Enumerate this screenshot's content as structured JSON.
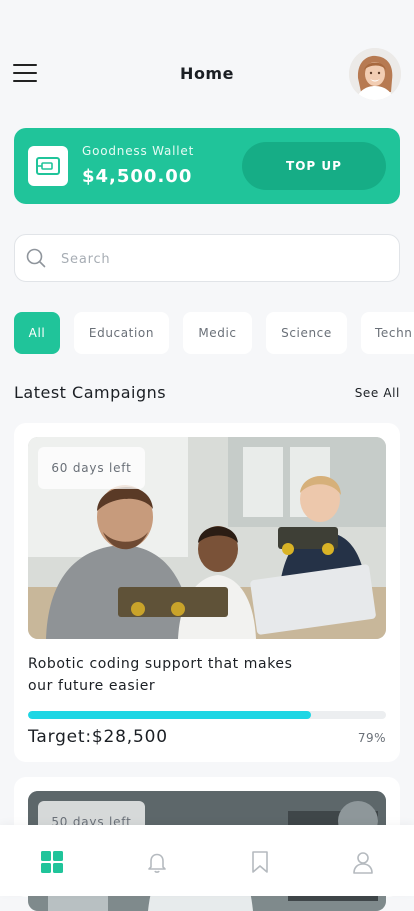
{
  "header": {
    "title": "Home",
    "menu_icon": "hamburger-menu-icon",
    "avatar_icon": "user-avatar"
  },
  "wallet": {
    "name": "Goodness Wallet",
    "amount": "$4,500.00",
    "topup_label": "TOP UP",
    "icon": "wallet-card-icon",
    "accent": "#20c49a"
  },
  "search": {
    "placeholder": "Search",
    "value": "",
    "icon": "search-icon"
  },
  "categories": [
    {
      "label": "All",
      "active": true
    },
    {
      "label": "Education",
      "active": false
    },
    {
      "label": "Medic",
      "active": false
    },
    {
      "label": "Science",
      "active": false
    },
    {
      "label": "Techn",
      "active": false
    }
  ],
  "section": {
    "title": "Latest Campaigns",
    "see_all": "See All"
  },
  "campaigns": [
    {
      "days_left": "60 days left",
      "title": "Robotic coding support that makes our future easier",
      "target": "Target:$28,500",
      "progress_percent": 79,
      "progress_label": "79%",
      "progress_color": "#1ed6e4"
    },
    {
      "days_left": "50 days left"
    }
  ],
  "bottom_nav": [
    {
      "icon": "home-grid-icon",
      "active": true,
      "color": "#20c49a"
    },
    {
      "icon": "bell-icon",
      "active": false
    },
    {
      "icon": "bookmark-icon",
      "active": false
    },
    {
      "icon": "profile-icon",
      "active": false
    }
  ]
}
